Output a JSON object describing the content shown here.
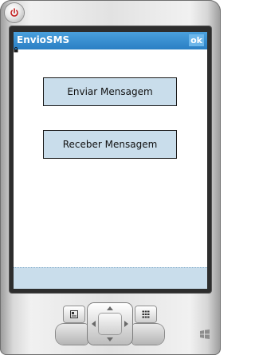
{
  "window": {
    "title": "EnvioSMS",
    "ok_label": "ok"
  },
  "main": {
    "send_button_label": "Enviar Mensagem",
    "receive_button_label": "Receber Mensagem"
  },
  "icons": {
    "power": "power-icon",
    "lock": "lock-icon",
    "left_softkey": "contacts-icon",
    "right_softkey": "keypad-icon",
    "logo": "windows-logo-icon"
  },
  "colors": {
    "titlebar": "#2a7fc4",
    "ok_button": "#6cb6ea",
    "button_fill": "#c9ddeb",
    "softbar": "#c9ddeb"
  }
}
